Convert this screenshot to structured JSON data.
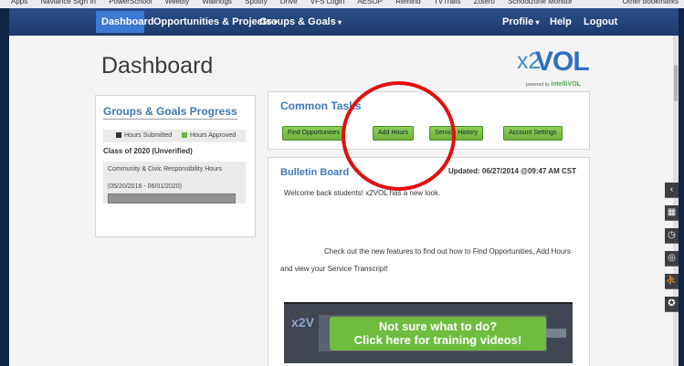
{
  "bookmarks": [
    "Apps",
    "Naviance Sign In",
    "PowerSchool",
    "Weebly",
    "Wallhogs",
    "Spotify",
    "Drive",
    "VFS Login",
    "AESOP",
    "Remind",
    "TVTrails",
    "Zotero",
    "Schoolzone Monitor"
  ],
  "bookmarks_right": "Other bookmarks",
  "nav": {
    "dashboard": "Dashboard",
    "opportunities": "Opportunities & Projects",
    "groups": "Groups & Goals",
    "profile": "Profile",
    "help": "Help",
    "logout": "Logout"
  },
  "page_title": "Dashboard",
  "logo": {
    "x": "x2",
    "vol": "VOL",
    "powered": "powered by",
    "brand": "intelliVOL"
  },
  "groups_goals": {
    "title": "Groups & Goals Progress",
    "legend_submitted": "Hours Submitted",
    "legend_approved": "Hours Approved",
    "class_line": "Class of 2020 (Unverified)",
    "requirement": "Community & Civic Responsibility Hours",
    "dates": "(05/20/2016 - 06/01/2020)"
  },
  "common_tasks": {
    "title": "Common Tasks",
    "buttons": [
      "Find Opportunities",
      "Add Hours",
      "Service History",
      "Account Settings"
    ]
  },
  "bulletin": {
    "title": "Bulletin Board",
    "updated": "Updated: 06/27/2014 @09:47 AM CST",
    "welcome": "Welcome back students! x2VOL has a new look.",
    "check": "Check out the new features to find out how to Find Opportunities, Add Hours and view your Service Transcript!",
    "video_line1": "Not sure what to do?",
    "video_line2": "Click here for training videos!",
    "video_brand": "x2V"
  },
  "colors": {
    "nav": "#1d3a6c",
    "nav_active": "#3d7ad6",
    "accent_green": "#6db33c",
    "title_blue": "#3d79b8",
    "annotation_red": "#e11010",
    "hours_submitted": "#333333",
    "hours_approved": "#6db33c"
  },
  "rail_icons": [
    "chevron-left-icon",
    "calendar-icon",
    "alarm-clock-icon",
    "target-icon",
    "runner-icon",
    "award-icon"
  ]
}
